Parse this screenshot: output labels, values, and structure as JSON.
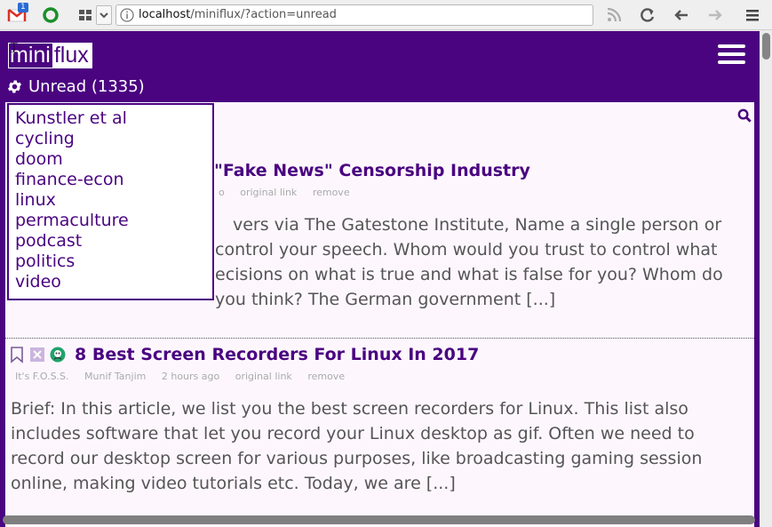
{
  "browser": {
    "gmail_badge": "1",
    "url_host": "localhost",
    "url_path": "/miniflux/?action=unread"
  },
  "app": {
    "logo_part1": "mini",
    "logo_part2": "flux",
    "unread_label": "Unread (1335)"
  },
  "categories": [
    "Kunstler et al",
    "cycling",
    "doom",
    "finance-econ",
    "linux",
    "permaculture",
    "podcast",
    "politics",
    "video"
  ],
  "articles": [
    {
      "title_visible": "\"Fake News\" Censorship Industry",
      "meta_visible": [
        "o",
        "original link",
        "remove"
      ],
      "body_lines": [
        "vers via The Gatestone Institute, Name a single person or",
        "control your speech. Whom would you trust to control what",
        "ecisions on what is true and what is false for you? Whom do",
        "you think? The German government [...]"
      ]
    },
    {
      "title": "8 Best Screen Recorders For Linux In 2017",
      "feed": "It's F.O.S.S.",
      "author": "Munif Tanjim",
      "time": "2 hours ago",
      "link_label": "original link",
      "remove_label": "remove",
      "body": "Brief: In this article, we list you the best screen recorders for Linux. This list also includes software that let you record your Linux desktop as gif. Often we need to record our desktop screen for various purposes, like broadcasting gaming session online, making video tutorials etc. Today, we are [...]"
    }
  ],
  "icons": {
    "bookmark": "bookmark-icon",
    "mark_read": "mark-read-icon",
    "feed": "feed-icon",
    "search": "search-icon",
    "settings": "gear-icon"
  },
  "colors": {
    "brand": "#4a0480",
    "background": "#fdf7fd",
    "text": "#555555",
    "meta": "#aaaaaa"
  }
}
